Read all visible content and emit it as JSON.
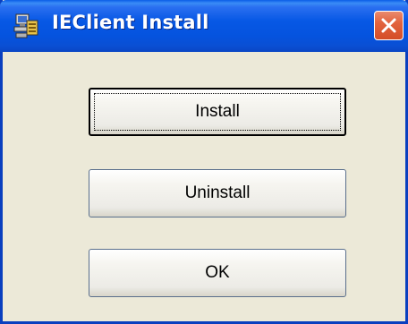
{
  "window": {
    "title": "IEClient Install",
    "icon": "installer-computer-icon",
    "close_icon": "close-x-icon",
    "titlebar_color": "#0553de",
    "close_color": "#d44d26"
  },
  "buttons": {
    "install_label": "Install",
    "uninstall_label": "Uninstall",
    "ok_label": "OK"
  }
}
